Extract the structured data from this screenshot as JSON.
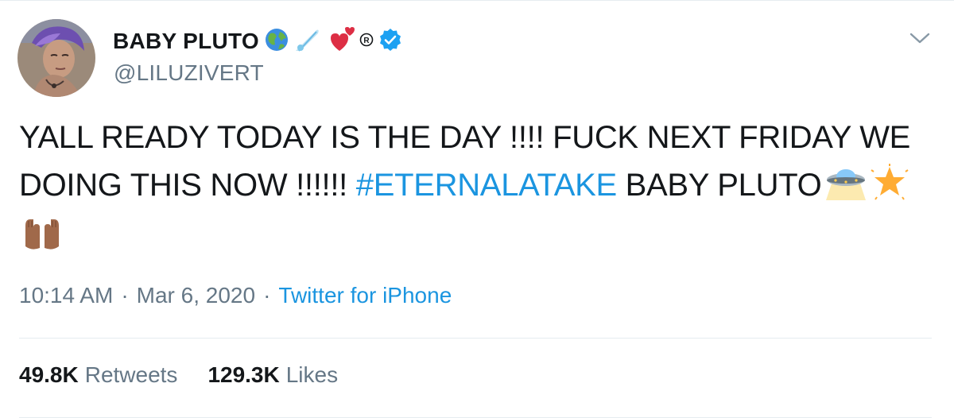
{
  "tweet": {
    "author": {
      "display_name": "BABY PLUTO",
      "handle": "@LILUZIVERT",
      "name_emojis": [
        "globe-emoji",
        "comet-emoji",
        "hearts-emoji",
        "registered-emoji"
      ],
      "verified_icon": "verified-badge-icon"
    },
    "menu_icon": "chevron-down-icon",
    "text": {
      "line_part1": "YALL READY TODAY IS THE DAY !!!! FUCK NEXT FRIDAY WE DOING THIS NOW !!!!!! ",
      "hashtag": "#ETERNALATAKE",
      "line_part2": " BABY PLUTO",
      "trailing_emojis": [
        "ufo-emoji",
        "glowing-star-emoji",
        "palms-up-emoji"
      ]
    },
    "meta": {
      "time": "10:14 AM",
      "date": "Mar 6, 2020",
      "separator": "·",
      "source": "Twitter for iPhone"
    },
    "stats": {
      "retweets_count": "49.8K",
      "retweets_label": "Retweets",
      "likes_count": "129.3K",
      "likes_label": "Likes"
    },
    "colors": {
      "link": "#1b95e0",
      "text": "#14171a",
      "secondary": "#657786",
      "divider": "#e6ecf0",
      "verified": "#1da1f2"
    }
  }
}
